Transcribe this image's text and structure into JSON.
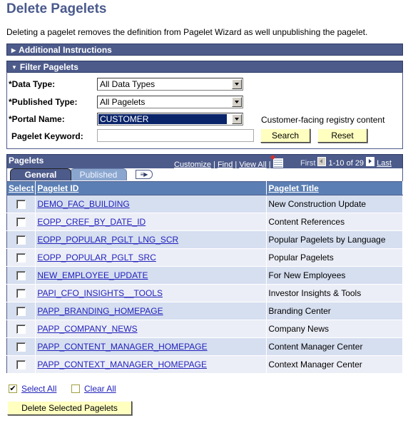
{
  "page": {
    "title": "Delete Pagelets",
    "description": "Deleting a pagelet removes the definition from Pagelet Wizard as well unpublishing the pagelet."
  },
  "sections": {
    "additional_instructions": "Additional Instructions",
    "filter_pagelets": "Filter Pagelets"
  },
  "filter": {
    "data_type_label": "*Data Type:",
    "data_type_value": "All Data Types",
    "published_type_label": "*Published Type:",
    "published_type_value": "All Pagelets",
    "portal_name_label": "*Portal Name:",
    "portal_name_value": "CUSTOMER",
    "portal_description": "Customer-facing registry content",
    "keyword_label": "Pagelet Keyword:",
    "keyword_value": "",
    "search_button": "Search",
    "reset_button": "Reset"
  },
  "grid": {
    "title": "Pagelets",
    "customize": "Customize",
    "find": "Find",
    "view_all": "View All",
    "separator": "|",
    "first": "First",
    "range": "1-10 of 29",
    "last": "Last",
    "tabs": [
      {
        "label": "General",
        "active": true
      },
      {
        "label": "Published",
        "active": false
      }
    ],
    "columns": [
      "Select",
      "Pagelet ID",
      "Pagelet Title"
    ],
    "rows": [
      {
        "id": "DEMO_FAC_BUILDING",
        "title": "New Construction Update",
        "selected": false
      },
      {
        "id": "EOPP_CREF_BY_DATE_ID",
        "title": "Content References",
        "selected": false
      },
      {
        "id": "EOPP_POPULAR_PGLT_LNG_SCR",
        "title": "Popular Pagelets by Language",
        "selected": false
      },
      {
        "id": "EOPP_POPULAR_PGLT_SRC",
        "title": "Popular Pagelets",
        "selected": false
      },
      {
        "id": "NEW_EMPLOYEE_UPDATE",
        "title": "For New Employees",
        "selected": false
      },
      {
        "id": "PAPI_CFO_INSIGHTS__TOOLS",
        "title": "Investor Insights & Tools",
        "selected": false
      },
      {
        "id": "PAPP_BRANDING_HOMEPAGE",
        "title": "Branding Center",
        "selected": false
      },
      {
        "id": "PAPP_COMPANY_NEWS",
        "title": "Company News",
        "selected": false
      },
      {
        "id": "PAPP_CONTENT_MANAGER_HOMEPAGE",
        "title": "Content Manager Center",
        "selected": false
      },
      {
        "id": "PAPP_CONTEXT_MANAGER_HOMEPAGE",
        "title": "Context Manager Center",
        "selected": false
      }
    ]
  },
  "actions": {
    "select_all": "Select All",
    "clear_all": "Clear All",
    "delete_button": "Delete Selected Pagelets",
    "check_glyph": "✔"
  },
  "icons": {
    "collapsed": "▶",
    "expanded": "▼",
    "expand_tabs": "≡▶"
  }
}
